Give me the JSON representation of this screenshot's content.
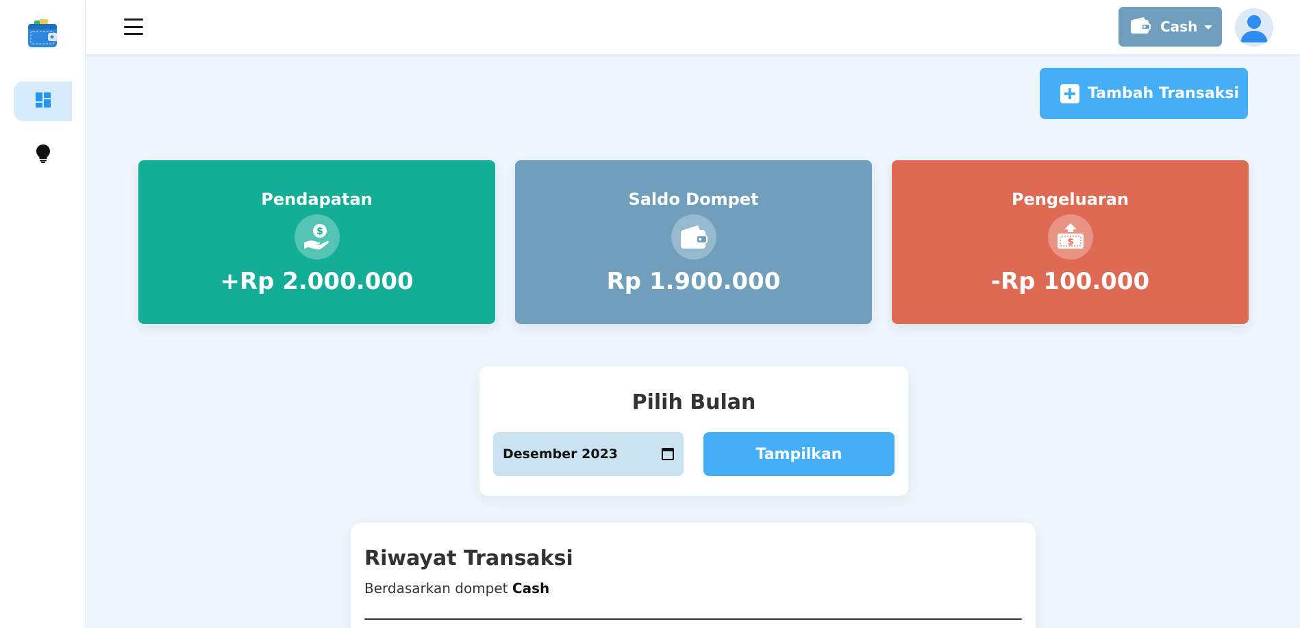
{
  "sidebar": {
    "items": [
      {
        "name": "dashboard",
        "icon": "dashboard-icon",
        "active": true
      },
      {
        "name": "tips",
        "icon": "lightbulb-icon",
        "active": false
      }
    ]
  },
  "header": {
    "wallet_selector": {
      "label": "Cash",
      "icon": "wallet-icon"
    }
  },
  "actions": {
    "add_transaction_label": "Tambah Transaksi"
  },
  "stats": {
    "income": {
      "title": "Pendapatan",
      "value": "+Rp 2.000.000",
      "color": "#14ad95",
      "icon": "money-hand-icon"
    },
    "balance": {
      "title": "Saldo Dompet",
      "value": "Rp 1.900.000",
      "color": "#6f9fbb",
      "icon": "wallet-icon"
    },
    "expense": {
      "title": "Pengeluaran",
      "value": "-Rp 100.000",
      "color": "#df6a54",
      "icon": "money-out-icon"
    }
  },
  "month_picker": {
    "title": "Pilih Bulan",
    "value": "Desember 2023",
    "button_label": "Tampilkan"
  },
  "history": {
    "title": "Riwayat Transaksi",
    "subtitle_prefix": "Berdasarkan dompet",
    "wallet": "Cash"
  },
  "colors": {
    "accent": "#44aef6",
    "background": "#eef6fd"
  }
}
